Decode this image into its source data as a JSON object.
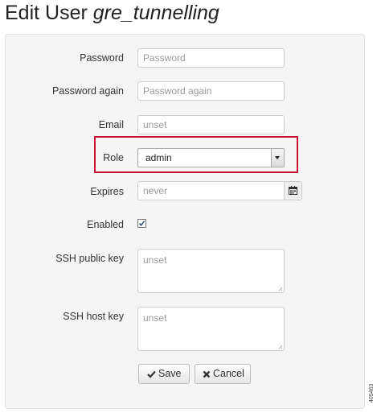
{
  "page": {
    "title_prefix": "Edit User ",
    "username": "gre_tunnelling"
  },
  "form": {
    "password": {
      "label": "Password",
      "placeholder": "Password"
    },
    "password_again": {
      "label": "Password again",
      "placeholder": "Password again"
    },
    "email": {
      "label": "Email",
      "placeholder": "unset"
    },
    "role": {
      "label": "Role",
      "value": "admin"
    },
    "expires": {
      "label": "Expires",
      "placeholder": "never",
      "icon": "calendar-icon"
    },
    "enabled": {
      "label": "Enabled",
      "checked": true
    },
    "ssh_public_key": {
      "label": "SSH public key",
      "placeholder": "unset"
    },
    "ssh_host_key": {
      "label": "SSH host key",
      "placeholder": "unset"
    }
  },
  "actions": {
    "save_label": "Save",
    "save_icon": "checkmark-icon",
    "cancel_label": "Cancel",
    "cancel_icon": "x-icon"
  },
  "highlight_color": "#c8102e",
  "figure_id": "405463"
}
